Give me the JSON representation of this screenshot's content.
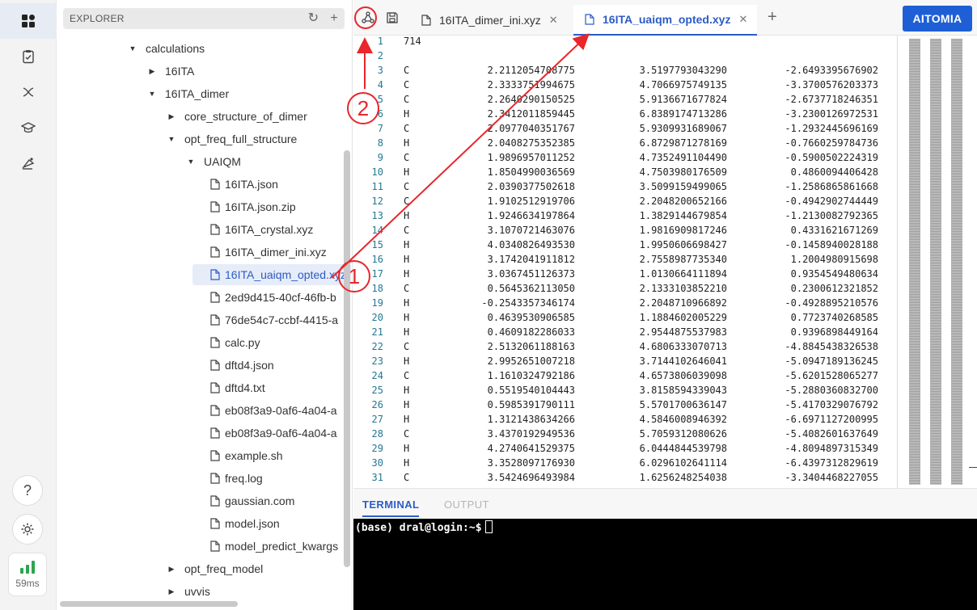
{
  "activity_bar": {
    "icons": [
      "dashboard-icon",
      "tasks-icon",
      "molecule-icon",
      "graduation-cap-icon",
      "flask-icon"
    ],
    "help_icon": "?",
    "settings_icon": "gear",
    "latency": "59ms",
    "latency_color": "#2ea44f"
  },
  "explorer": {
    "title": "EXPLORER",
    "tree": [
      {
        "label": "calculations",
        "level": 0,
        "type": "folder-open"
      },
      {
        "label": "16ITA",
        "level": 1,
        "type": "folder-closed"
      },
      {
        "label": "16ITA_dimer",
        "level": 1,
        "type": "folder-open"
      },
      {
        "label": "core_structure_of_dimer",
        "level": 2,
        "type": "folder-closed"
      },
      {
        "label": "opt_freq_full_structure",
        "level": 2,
        "type": "folder-open"
      },
      {
        "label": "UAIQM",
        "level": 3,
        "type": "folder-open"
      },
      {
        "label": "16ITA.json",
        "level": 4,
        "type": "file"
      },
      {
        "label": "16ITA.json.zip",
        "level": 4,
        "type": "file"
      },
      {
        "label": "16ITA_crystal.xyz",
        "level": 4,
        "type": "file"
      },
      {
        "label": "16ITA_dimer_ini.xyz",
        "level": 4,
        "type": "file"
      },
      {
        "label": "16ITA_uaiqm_opted.xyz",
        "level": 4,
        "type": "file",
        "selected": true
      },
      {
        "label": "2ed9d415-40cf-46fb-b",
        "level": 4,
        "type": "file"
      },
      {
        "label": "76de54c7-ccbf-4415-a",
        "level": 4,
        "type": "file"
      },
      {
        "label": "calc.py",
        "level": 4,
        "type": "file"
      },
      {
        "label": "dftd4.json",
        "level": 4,
        "type": "file"
      },
      {
        "label": "dftd4.txt",
        "level": 4,
        "type": "file"
      },
      {
        "label": "eb08f3a9-0af6-4a04-a",
        "level": 4,
        "type": "file"
      },
      {
        "label": "eb08f3a9-0af6-4a04-a",
        "level": 4,
        "type": "file"
      },
      {
        "label": "example.sh",
        "level": 4,
        "type": "file"
      },
      {
        "label": "freq.log",
        "level": 4,
        "type": "file"
      },
      {
        "label": "gaussian.com",
        "level": 4,
        "type": "file"
      },
      {
        "label": "model.json",
        "level": 4,
        "type": "file"
      },
      {
        "label": "model_predict_kwargs",
        "level": 4,
        "type": "file"
      },
      {
        "label": "opt_freq_model",
        "level": 2,
        "type": "folder-closed"
      },
      {
        "label": "uvvis",
        "level": 2,
        "type": "folder-closed"
      }
    ]
  },
  "tabs": [
    {
      "label": "16ITA_dimer_ini.xyz",
      "active": false,
      "close": "✕"
    },
    {
      "label": "16ITA_uaiqm_opted.xyz",
      "active": true,
      "close": "✕"
    }
  ],
  "new_tab": "+",
  "aitomia_button": "AITOMIA",
  "accent_color": "#1f5fd6",
  "editor": {
    "lines": [
      {
        "n": "1",
        "text": "714"
      },
      {
        "n": "2",
        "text": ""
      },
      {
        "n": "3",
        "el": "C",
        "x": "2.2112054708775",
        "y": "3.5197793043290",
        "z": "-2.6493395676902"
      },
      {
        "n": "4",
        "el": "C",
        "x": "2.3333751994675",
        "y": "4.7066975749135",
        "z": "-3.3700576203373"
      },
      {
        "n": "5",
        "el": "C",
        "x": "2.2640290150525",
        "y": "5.9136671677824",
        "z": "-2.6737718246351"
      },
      {
        "n": "6",
        "el": "H",
        "x": "2.3412011859445",
        "y": "6.8389174713286",
        "z": "-3.2300126972531"
      },
      {
        "n": "7",
        "el": "C",
        "x": "2.0977040351767",
        "y": "5.9309931689067",
        "z": "-1.2932445696169"
      },
      {
        "n": "8",
        "el": "H",
        "x": "2.0408275352385",
        "y": "6.8729871278169",
        "z": "-0.7660259784736"
      },
      {
        "n": "9",
        "el": "C",
        "x": "1.9896957011252",
        "y": "4.7352491104490",
        "z": "-0.5900502224319"
      },
      {
        "n": "10",
        "el": "H",
        "x": "1.8504990036569",
        "y": "4.7503980176509",
        "z": "0.4860094406428"
      },
      {
        "n": "11",
        "el": "C",
        "x": "2.0390377502618",
        "y": "3.5099159499065",
        "z": "-1.2586865861668"
      },
      {
        "n": "12",
        "el": "C",
        "x": "1.9102512919706",
        "y": "2.2048200652166",
        "z": "-0.4942902744449"
      },
      {
        "n": "13",
        "el": "H",
        "x": "1.9246634197864",
        "y": "1.3829144679854",
        "z": "-1.2130082792365"
      },
      {
        "n": "14",
        "el": "C",
        "x": "3.1070721463076",
        "y": "1.9816909817246",
        "z": "0.4331621671269"
      },
      {
        "n": "15",
        "el": "H",
        "x": "4.0340826493530",
        "y": "1.9950606698427",
        "z": "-0.1458940028188"
      },
      {
        "n": "16",
        "el": "H",
        "x": "3.1742041911812",
        "y": "2.7558987735340",
        "z": "1.2004980915698"
      },
      {
        "n": "17",
        "el": "H",
        "x": "3.0367451126373",
        "y": "1.0130664111894",
        "z": "0.9354549480634"
      },
      {
        "n": "18",
        "el": "C",
        "x": "0.5645362113050",
        "y": "2.1333103852210",
        "z": "0.2300612321852"
      },
      {
        "n": "19",
        "el": "H",
        "x": "-0.2543357346174",
        "y": "2.2048710966892",
        "z": "-0.4928895210576"
      },
      {
        "n": "20",
        "el": "H",
        "x": "0.4639530906585",
        "y": "1.1884602005229",
        "z": "0.7723740268585"
      },
      {
        "n": "21",
        "el": "H",
        "x": "0.4609182286033",
        "y": "2.9544875537983",
        "z": "0.9396898449164"
      },
      {
        "n": "22",
        "el": "C",
        "x": "2.5132061188163",
        "y": "4.6806333070713",
        "z": "-4.8845438326538"
      },
      {
        "n": "23",
        "el": "H",
        "x": "2.9952651007218",
        "y": "3.7144102646041",
        "z": "-5.0947189136245"
      },
      {
        "n": "24",
        "el": "C",
        "x": "1.1610324792186",
        "y": "4.6573806039098",
        "z": "-5.6201528065277"
      },
      {
        "n": "25",
        "el": "H",
        "x": "0.5519540104443",
        "y": "3.8158594339043",
        "z": "-5.2880360832700"
      },
      {
        "n": "26",
        "el": "H",
        "x": "0.5985391790111",
        "y": "5.5701700636147",
        "z": "-5.4170329076792"
      },
      {
        "n": "27",
        "el": "H",
        "x": "1.3121438634266",
        "y": "4.5846008946392",
        "z": "-6.6971127200995"
      },
      {
        "n": "28",
        "el": "C",
        "x": "3.4370192949536",
        "y": "5.7059312080626",
        "z": "-5.4082601637649"
      },
      {
        "n": "29",
        "el": "H",
        "x": "4.2740641529375",
        "y": "6.0444844539798",
        "z": "-4.8094897315349"
      },
      {
        "n": "30",
        "el": "H",
        "x": "3.3528097176930",
        "y": "6.0296102641114",
        "z": "-6.4397312829619"
      },
      {
        "n": "31",
        "el": "C",
        "x": "3.5424696493984",
        "y": "1.6256248254038",
        "z": "-3.3404468227055"
      }
    ]
  },
  "panel": {
    "tabs": [
      "TERMINAL",
      "OUTPUT"
    ],
    "terminal_prompt": "(base) dral@login:~$"
  },
  "annotations": {
    "labels": [
      "1",
      "2"
    ],
    "color": "#e8262b"
  }
}
